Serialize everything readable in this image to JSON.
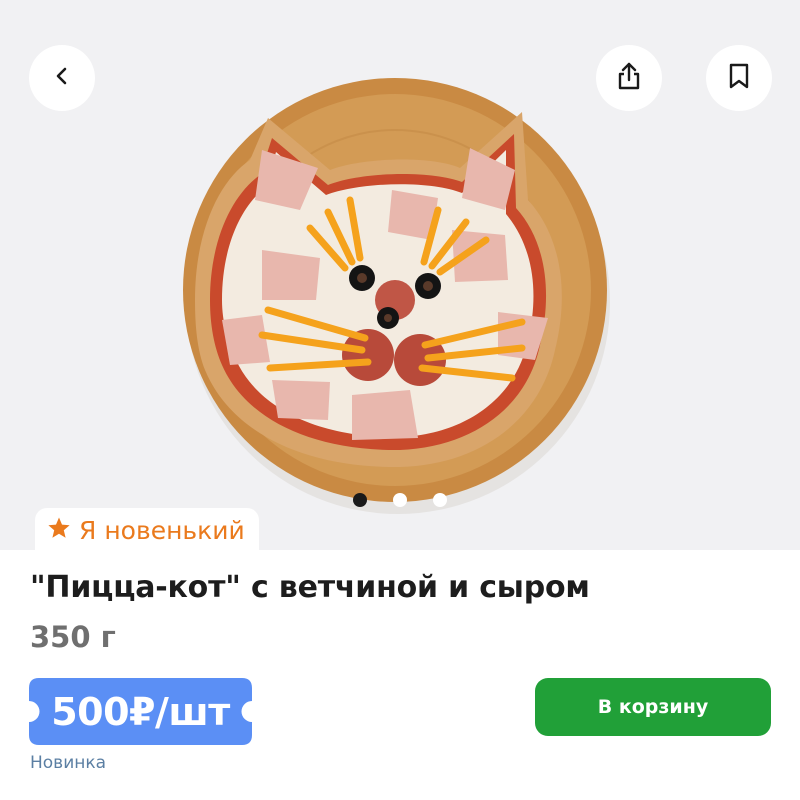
{
  "product": {
    "title": "\"Пицца-кот\" с ветчиной и сыром",
    "weight": "350 г",
    "price": "500₽/шт",
    "status_label": "Новинка",
    "badge": {
      "label": "Я новенький",
      "icon": "star-icon"
    },
    "add_to_cart_label": "В корзину",
    "image": {
      "current_slide": 1,
      "total_slides": 3
    }
  },
  "header": {
    "back_icon": "chevron-left-icon",
    "share_icon": "share-icon",
    "bookmark_icon": "bookmark-icon"
  },
  "colors": {
    "price_bg": "#5b8ff5",
    "cart_bg": "#21a038",
    "badge_text": "#ea7a1d",
    "status_label": "#5b7fa3",
    "hero_bg": "#f1f1f3"
  }
}
